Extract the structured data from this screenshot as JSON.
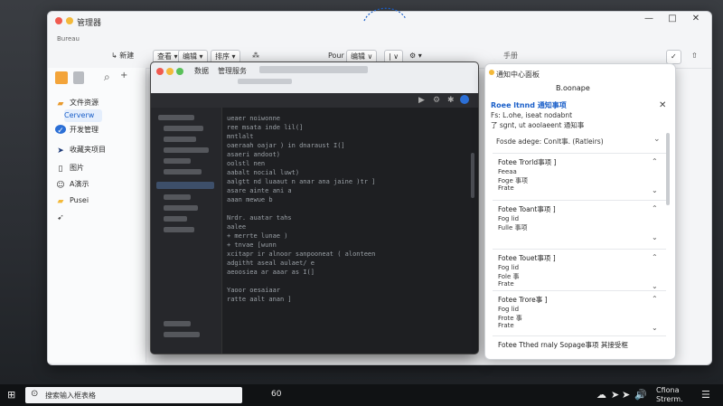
{
  "outer_window": {
    "title": "管理器",
    "subtitle": "Bureau",
    "ctrl_min": "—",
    "ctrl_max": "□",
    "ctrl_close": "✕",
    "toolbar": [
      {
        "label": "↳ 新建"
      },
      {
        "label": "查看 ▾"
      },
      {
        "label": "编辑 ▾"
      },
      {
        "label": "排序 ▾"
      },
      {
        "label": "⁂"
      }
    ],
    "toolbar_center": [
      {
        "label": "Pour"
      },
      {
        "label": "编辑 ∨"
      },
      {
        "label": "| ∨"
      },
      {
        "label": "⚙ ▾"
      }
    ],
    "right_label": "手册",
    "right_icons": [
      "✓",
      "⇧"
    ]
  },
  "sidebar": {
    "items": [
      {
        "label": "文件资源",
        "icon": "folder-icon"
      },
      {
        "label": "Cerverw",
        "icon": "search-icon",
        "selected": true
      },
      {
        "label": "开发管理",
        "icon": "check-icon"
      },
      {
        "label": "收藏夹项目",
        "icon": "flag-icon"
      },
      {
        "label": "图片",
        "icon": "image-icon"
      },
      {
        "label": "A演示",
        "icon": "people-icon"
      },
      {
        "label": "Pusei",
        "icon": "folder-icon"
      },
      {
        "label": "",
        "icon": "arrow-icon"
      }
    ]
  },
  "ide": {
    "tabs": [
      "数据",
      "管理服务"
    ],
    "code_lines": [
      "ueaer noiwonne",
      "    ree msata inde lil(]",
      "             mntlalt",
      "    oaeraah oajar ) in  dnaraust I(]",
      "    asaeri andoot)",
      "           oolstl nen",
      "        aabalt nocial luwt)",
      "          aalgtt nd luaaut n anar ana jaine )tr ]",
      "          asare ainte ani a",
      "            aaan mewue b",
      "",
      "    Nrdr. auatar tahs",
      "    aalee",
      "      + merrte lunae )",
      "        +  tnvae [wunn",
      "     xcitapr  ir  alnoor  sanpooneat ( alonteen",
      "        adgitht aseal aulaet/  e",
      "           aeoosiea ar  aaar as I(]",
      "",
      "    Yaoor oesaiaar",
      "    ratte  aalt anan ]"
    ]
  },
  "panel": {
    "title": "通知中心面板",
    "subtitle": "B.oonape",
    "head1": "Roee ltnnd 通知事项",
    "head2": "Fs: L.ohe, iseat nodabnt",
    "head3": "了 sgnt, ut aoolaeent 通知事",
    "close": "✕",
    "section": "Fosde adege: Conlt事. (Ratleirs)",
    "cards": [
      {
        "title": "Fotee Trorld事项 ]",
        "l1": "Feeaa",
        "l2": "Foge 事项",
        "l3": "Frate"
      },
      {
        "title": "Fotee Toant事项 ]",
        "l1": "Fog lid",
        "l2": "Fulle 事项",
        "l3": ""
      },
      {
        "title": "Fotee Touet事项 ]",
        "l1": "Fog lid",
        "l2": "Fole 事",
        "l3": "Frate"
      },
      {
        "title": "Fotee Trore事 ]",
        "l1": "Fog lid",
        "l2": "Frote 事",
        "l3": "Frate"
      },
      {
        "title": "Fotee Tthed rnaly Sopage事项  其接受框",
        "l1": "",
        "l2": "",
        "l3": ""
      }
    ]
  },
  "taskbar": {
    "start": "⊞",
    "search_text": "搜索输入框表格",
    "center_num": "60",
    "tray_icons": [
      "☁",
      "➤",
      "➤",
      "🔊"
    ],
    "tray_text": "Cfiona Strerm.",
    "notif": "☰"
  }
}
